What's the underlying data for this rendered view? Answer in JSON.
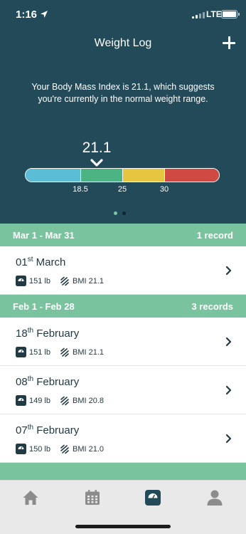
{
  "status_bar": {
    "time": "1:16",
    "carrier": "LTE"
  },
  "header": {
    "title": "Weight Log"
  },
  "bmi": {
    "message": "Your Body Mass Index is 21.1, which suggests you're currently in the normal weight range.",
    "value": "21.1",
    "ticks": [
      "18.5",
      "25",
      "30"
    ],
    "colors": {
      "underweight": "#5bbdd6",
      "normal": "#4cb483",
      "overweight": "#e6c641",
      "obese": "#cf4a43"
    }
  },
  "pager": {
    "pages": 2,
    "active_page": 1
  },
  "groups": [
    {
      "range": "Mar 1 - Mar 31",
      "count": "1 record",
      "records": [
        {
          "day": "01",
          "suffix": "st",
          "month": "March",
          "weight": "151 lb",
          "bmi": "BMI 21.1"
        }
      ]
    },
    {
      "range": "Feb 1 - Feb 28",
      "count": "3 records",
      "records": [
        {
          "day": "18",
          "suffix": "th",
          "month": "February",
          "weight": "151 lb",
          "bmi": "BMI 21.1"
        },
        {
          "day": "08",
          "suffix": "th",
          "month": "February",
          "weight": "149 lb",
          "bmi": "BMI 20.8"
        },
        {
          "day": "07",
          "suffix": "th",
          "month": "February",
          "weight": "150 lb",
          "bmi": "BMI 21.0"
        }
      ]
    }
  ],
  "tabs": [
    {
      "icon": "home-icon",
      "active": false
    },
    {
      "icon": "calendar-icon",
      "active": false
    },
    {
      "icon": "scale-icon",
      "active": true
    },
    {
      "icon": "profile-icon",
      "active": false
    }
  ],
  "colors": {
    "header_bg": "#234a58",
    "accent_green": "#7ac39f",
    "text_dark": "#223a44"
  }
}
